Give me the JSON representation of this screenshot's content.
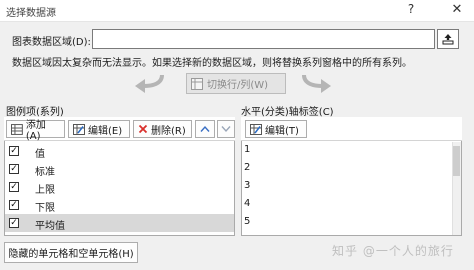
{
  "window": {
    "title": "选择数据源",
    "help": "?",
    "close": "✕"
  },
  "range": {
    "label": "图表数据区域(D):",
    "value": ""
  },
  "note": "数据区域因太复杂而无法显示。如果选择新的数据区域，则将替换系列窗格中的所有系列。",
  "switch_label": "切换行/列(W)",
  "legend": {
    "label": "图例项(系列)",
    "add_label": "添加(A)",
    "edit_label": "编辑(E)",
    "delete_label": "删除(R)",
    "series": [
      {
        "name": "值",
        "checked": true,
        "selected": false
      },
      {
        "name": "标准",
        "checked": true,
        "selected": false
      },
      {
        "name": "上限",
        "checked": true,
        "selected": false
      },
      {
        "name": "下限",
        "checked": true,
        "selected": false
      },
      {
        "name": "平均值",
        "checked": true,
        "selected": true
      }
    ]
  },
  "axis": {
    "label": "水平(分类)轴标签(C)",
    "edit_label": "编辑(T)",
    "items": [
      "1",
      "2",
      "3",
      "4",
      "5"
    ]
  },
  "hidden_cells_label": "隐藏的单元格和空单元格(H)",
  "watermark": "知乎 @一个人的旅行",
  "colors": {
    "delete_red": "#d9302c",
    "arrow_gray": "#b5b5b5",
    "up_blue": "#3a6fc4"
  }
}
